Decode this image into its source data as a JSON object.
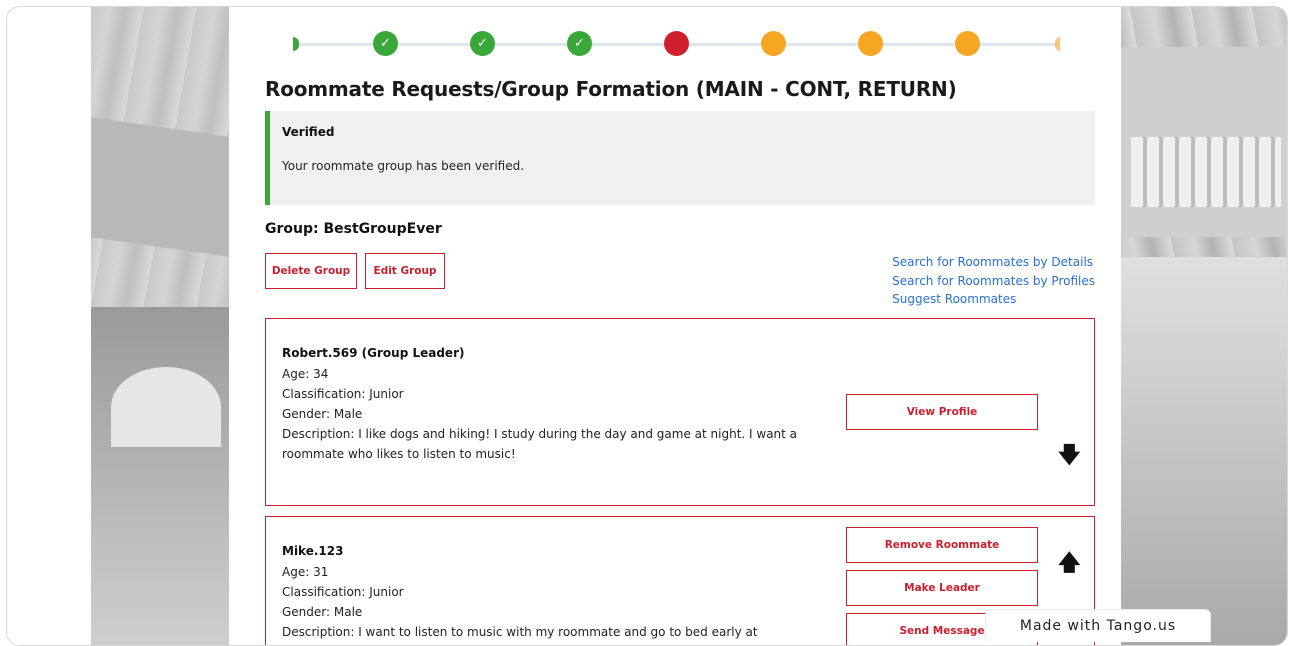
{
  "stepper": {
    "steps": [
      {
        "status": "done",
        "color": "#3aa839",
        "icon": "check-icon"
      },
      {
        "status": "done",
        "color": "#3aa839",
        "icon": "check-icon"
      },
      {
        "status": "done",
        "color": "#3aa839",
        "icon": "check-icon"
      },
      {
        "status": "current",
        "color": "#d0202e",
        "icon": ""
      },
      {
        "status": "pending",
        "color": "#f5a623",
        "icon": ""
      },
      {
        "status": "pending",
        "color": "#f5a623",
        "icon": ""
      },
      {
        "status": "pending",
        "color": "#f5a623",
        "icon": ""
      }
    ]
  },
  "page": {
    "title": "Roommate Requests/Group Formation (MAIN - CONT, RETURN)"
  },
  "alert": {
    "title": "Verified",
    "message": "Your roommate group has been verified.",
    "accent": "#3aa839"
  },
  "group": {
    "title": "Group: BestGroupEver",
    "delete_label": "Delete Group",
    "edit_label": "Edit Group"
  },
  "links": {
    "details": "Search for Roommates by Details",
    "profiles": "Search for Roommates by Profiles",
    "suggest": "Suggest Roommates"
  },
  "members": [
    {
      "name": "Robert.569 (Group Leader)",
      "age": "Age: 34",
      "classification": "Classification: Junior",
      "gender": "Gender: Male",
      "description": "Description: I like dogs and hiking! I study during the day and game at night. I want a roommate who likes to listen to music!",
      "view_profile_label": "View Profile",
      "arrow": "arrow-down-icon"
    },
    {
      "name": "Mike.123",
      "age": "Age: 31",
      "classification": "Classification: Junior",
      "gender": "Gender: Male",
      "description": "Description: I want to listen to music with my roommate and go to bed early at",
      "remove_label": "Remove Roommate",
      "make_leader_label": "Make Leader",
      "send_message_label": "Send Message",
      "arrow": "arrow-up-icon"
    }
  ],
  "watermark": {
    "text": "Made with Tango.us"
  },
  "colors": {
    "brand_red": "#c8202f",
    "link_blue": "#2a6fd6"
  }
}
